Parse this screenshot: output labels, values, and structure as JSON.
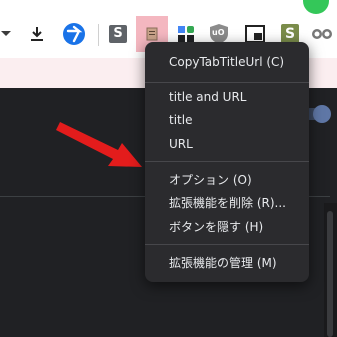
{
  "toolbar": {
    "icons": [
      "chevron-down-icon",
      "download-icon",
      "blue-circle-arrow-icon",
      "s-extension-icon",
      "copytabtitleurl-icon",
      "puzzle-icon",
      "ublock-icon",
      "picture-in-picture-icon",
      "s-green-extension-icon",
      "glasses-icon"
    ],
    "s_letter": "S",
    "s_green_letter": "S",
    "ublock_letter": "uO",
    "colors": {
      "accent_blue": "#1a73e8",
      "active_extension_bg": "#f4b7c0"
    }
  },
  "menu": {
    "items": [
      {
        "label": "CopyTabTitleUrl (C)"
      },
      {
        "label": "title and URL"
      },
      {
        "label": "title"
      },
      {
        "label": "URL"
      },
      {
        "label": "オプション (O)"
      },
      {
        "label": "拡張機能を削除 (R)..."
      },
      {
        "label": "ボタンを隠す (H)"
      },
      {
        "label": "拡張機能の管理 (M)"
      }
    ]
  },
  "annotation": {
    "arrow_color": "#e31c1c"
  }
}
